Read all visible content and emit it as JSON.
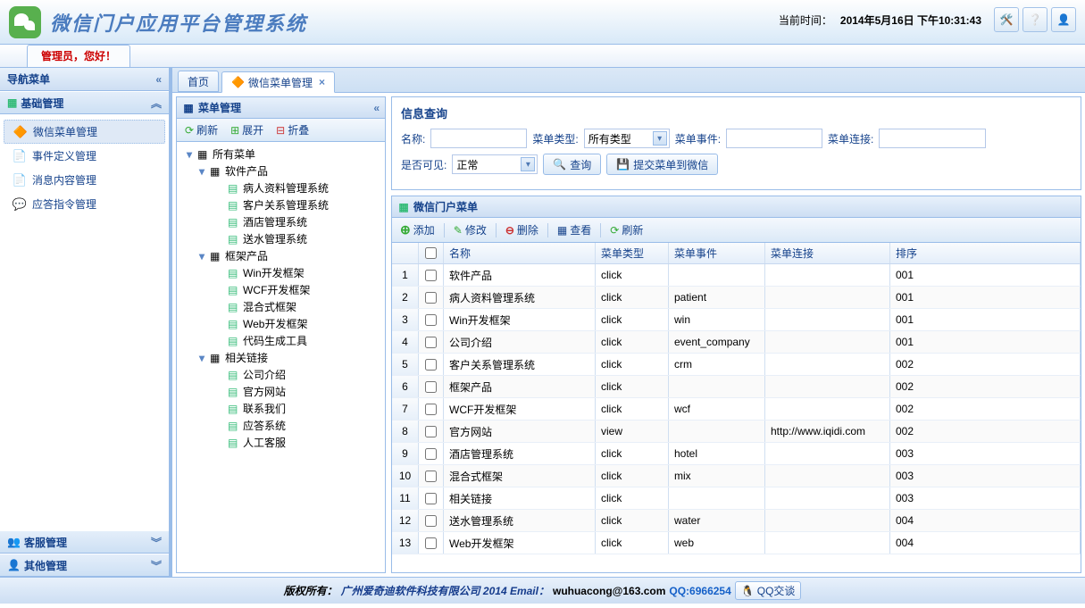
{
  "header": {
    "app_title": "微信门户应用平台管理系统",
    "time_label": "当前时间：",
    "time_value": "2014年5月16日 下午10:31:43"
  },
  "userbar": {
    "greeting": "管理员，您好！"
  },
  "nav": {
    "title": "导航菜单",
    "sections": [
      {
        "title": "基础管理",
        "expanded": true,
        "items": [
          {
            "label": "微信菜单管理",
            "icon": "menu",
            "selected": true
          },
          {
            "label": "事件定义管理",
            "icon": "event"
          },
          {
            "label": "消息内容管理",
            "icon": "msg"
          },
          {
            "label": "应答指令管理",
            "icon": "reply"
          }
        ]
      },
      {
        "title": "客服管理",
        "expanded": false
      },
      {
        "title": "其他管理",
        "expanded": false
      }
    ]
  },
  "tabs": [
    {
      "label": "首页",
      "closable": false
    },
    {
      "label": "微信菜单管理",
      "closable": true,
      "active": true
    }
  ],
  "tree": {
    "title": "菜单管理",
    "toolbar": {
      "refresh": "刷新",
      "expand": "展开",
      "collapse": "折叠"
    },
    "root": "所有菜单",
    "nodes": [
      {
        "label": "软件产品",
        "children": [
          "病人资料管理系统",
          "客户关系管理系统",
          "酒店管理系统",
          "送水管理系统"
        ]
      },
      {
        "label": "框架产品",
        "children": [
          "Win开发框架",
          "WCF开发框架",
          "混合式框架",
          "Web开发框架",
          "代码生成工具"
        ]
      },
      {
        "label": "相关链接",
        "children": [
          "公司介绍",
          "官方网站",
          "联系我们",
          "应答系统",
          "人工客服"
        ]
      }
    ]
  },
  "search": {
    "title": "信息查询",
    "labels": {
      "name": "名称:",
      "type": "菜单类型:",
      "event": "菜单事件:",
      "link": "菜单连接:",
      "visible": "是否可见:"
    },
    "type_value": "所有类型",
    "visible_value": "正常",
    "query_btn": "查询",
    "submit_btn": "提交菜单到微信"
  },
  "grid": {
    "title": "微信门户菜单",
    "toolbar": {
      "add": "添加",
      "edit": "修改",
      "del": "删除",
      "view": "查看",
      "refresh": "刷新"
    },
    "columns": {
      "name": "名称",
      "type": "菜单类型",
      "event": "菜单事件",
      "link": "菜单连接",
      "order": "排序"
    },
    "rows": [
      {
        "name": "软件产品",
        "type": "click",
        "event": "",
        "link": "",
        "order": "001"
      },
      {
        "name": "病人资料管理系统",
        "type": "click",
        "event": "patient",
        "link": "",
        "order": "001"
      },
      {
        "name": "Win开发框架",
        "type": "click",
        "event": "win",
        "link": "",
        "order": "001"
      },
      {
        "name": "公司介绍",
        "type": "click",
        "event": "event_company",
        "link": "",
        "order": "001"
      },
      {
        "name": "客户关系管理系统",
        "type": "click",
        "event": "crm",
        "link": "",
        "order": "002"
      },
      {
        "name": "框架产品",
        "type": "click",
        "event": "",
        "link": "",
        "order": "002"
      },
      {
        "name": "WCF开发框架",
        "type": "click",
        "event": "wcf",
        "link": "",
        "order": "002"
      },
      {
        "name": "官方网站",
        "type": "view",
        "event": "",
        "link": "http://www.iqidi.com",
        "order": "002"
      },
      {
        "name": "酒店管理系统",
        "type": "click",
        "event": "hotel",
        "link": "",
        "order": "003"
      },
      {
        "name": "混合式框架",
        "type": "click",
        "event": "mix",
        "link": "",
        "order": "003"
      },
      {
        "name": "相关链接",
        "type": "click",
        "event": "",
        "link": "",
        "order": "003"
      },
      {
        "name": "送水管理系统",
        "type": "click",
        "event": "water",
        "link": "",
        "order": "004"
      },
      {
        "name": "Web开发框架",
        "type": "click",
        "event": "web",
        "link": "",
        "order": "004"
      }
    ]
  },
  "footer": {
    "copyright": "版权所有：",
    "company": "广州爱奇迪软件科技有限公司 2014 Email：",
    "email": "wuhuacong@163.com",
    "qq_label": "QQ:6966254",
    "qq_chat": "QQ交谈"
  }
}
